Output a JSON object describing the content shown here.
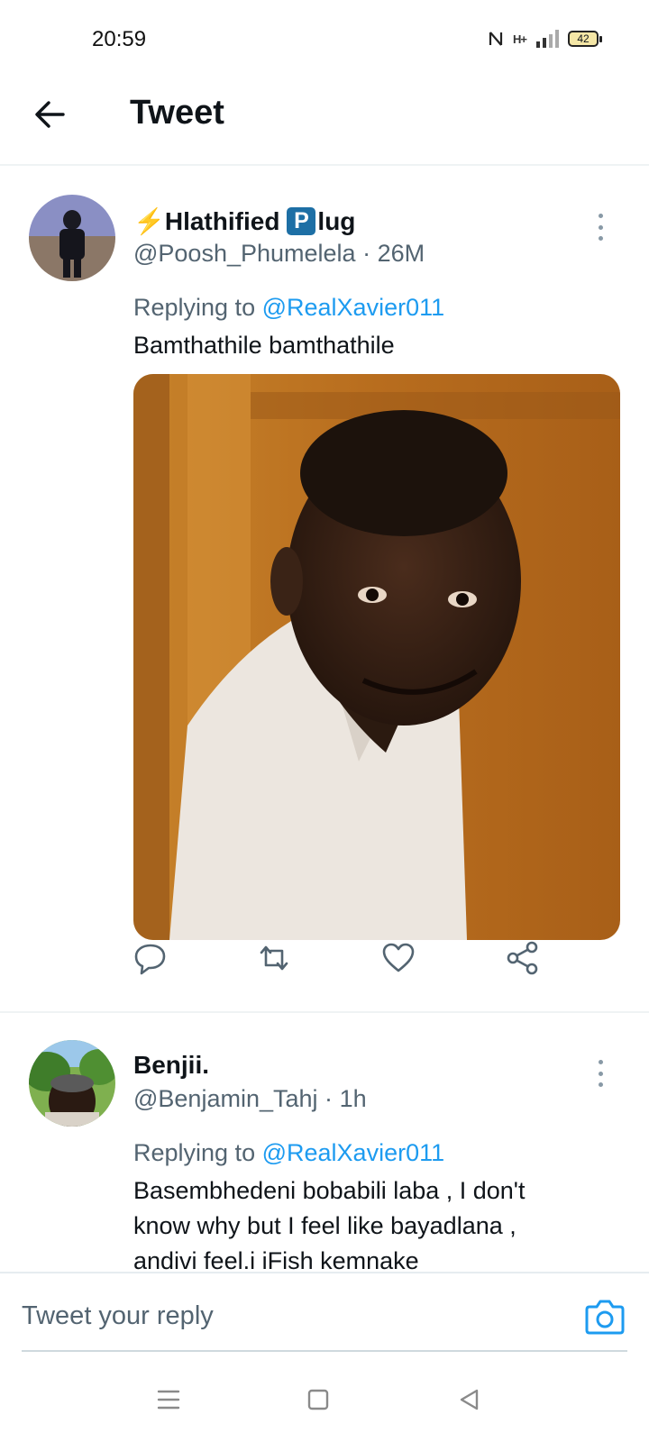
{
  "status_bar": {
    "time": "20:59",
    "network": "H+",
    "battery": "42",
    "icons": [
      "nfc-icon",
      "signal-icon",
      "battery-icon"
    ]
  },
  "header": {
    "title": "Tweet",
    "back_icon": "arrow-left-icon"
  },
  "tweets": [
    {
      "display_name": "⚡Hlathified",
      "badge_letter": "P",
      "name_suffix": "lug",
      "handle": "@Poosh_Phumelela",
      "separator": "·",
      "time": "26M",
      "replying_prefix": "Replying to",
      "replying_handle": "@RealXavier011",
      "text": "Bamthathile bamthathile",
      "has_media": true
    },
    {
      "display_name": "Benjii.",
      "handle": "@Benjamin_Tahj",
      "separator": "·",
      "time": "1h",
      "replying_prefix": "Replying to",
      "replying_handle": "@RealXavier011",
      "text_lines": [
        "Basembhedeni bobabili laba , I don't",
        "know why but I feel like bayadlana ,",
        "andivi feel.i iFish kemnake"
      ]
    }
  ],
  "actions": [
    "reply-icon",
    "retweet-icon",
    "like-icon",
    "share-icon"
  ],
  "composer": {
    "placeholder": "Tweet your reply",
    "camera_icon": "camera-icon"
  },
  "nav_bar": [
    "menu-icon",
    "home-square-icon",
    "back-triangle-icon"
  ],
  "colors": {
    "link": "#1d9bf0",
    "secondary_text": "#536471",
    "badge_blue": "#1d6fa5",
    "lightning": "#f5a623"
  }
}
